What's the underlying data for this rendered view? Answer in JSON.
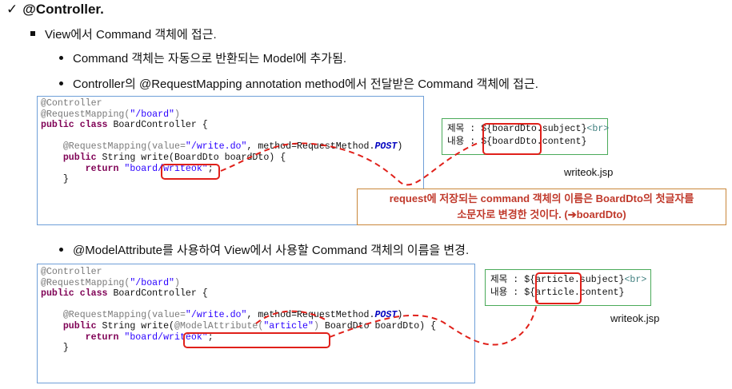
{
  "heading": {
    "check": "✓",
    "title": "@Controller."
  },
  "bullets": {
    "level1": "View에서 Command 객체에 접근.",
    "level2_a": "Command 객체는 자동으로 반환되는 Model에 추가됨.",
    "level2_b": "Controller의 @RequestMapping annotation method에서 전달받은 Command 객체에 접근.",
    "level2_c": "@ModelAttribute를 사용하여 View에서 사용할 Command 객체의 이름을 변경."
  },
  "example1": {
    "code": {
      "line1": "@Controller",
      "line2_ann": "@RequestMapping(",
      "line2_str": "\"/board\"",
      "line2_end": ")",
      "line3_kw1": "public",
      "line3_kw2": "class",
      "line3_rest": " BoardController {",
      "line5_ann": "@RequestMapping(value=",
      "line5_str": "\"/write.do\"",
      "line5_mid": ", method=RequestMethod.",
      "line5_const": "POST",
      "line5_end": ")",
      "line6_kw": "public",
      "line6_pre": " String write(",
      "line6_type": "BoardDto",
      "line6_rest": " boardDto) {",
      "line7_kw": "return",
      "line7_str": "\"board/writeok\"",
      "line7_end": ";",
      "line8": "}"
    },
    "jsp": {
      "label1": "제목 : $",
      "name1": "{boardDto.",
      "rest1": "subject}",
      "br": "<br>",
      "label2": "내용 : $",
      "name2": "{boardDto.",
      "rest2": "content}"
    },
    "jsp_caption": "writeok.jsp",
    "callout_line1": "request에 저장되는 command 객체의 이름은 BoardDto의 첫글자를",
    "callout_line2": "소문자로 변경한 것이다. (➔boardDto)"
  },
  "example2": {
    "code": {
      "line1": "@Controller",
      "line2_ann": "@RequestMapping(",
      "line2_str": "\"/board\"",
      "line2_end": ")",
      "line3_kw1": "public",
      "line3_kw2": "class",
      "line3_rest": " BoardController {",
      "line5_ann": "@RequestMapping(value=",
      "line5_str": "\"/write.do\"",
      "line5_mid": ", method=RequestMethod.",
      "line5_const": "POST",
      "line5_end": ")",
      "line6_kw": "public",
      "line6_pre": " String write(",
      "line6_ma": "@ModelAttribute(",
      "line6_ma_str": "\"article\"",
      "line6_ma_end": ")",
      "line6_rest": " BoardDto boardDto) {",
      "line7_kw": "return",
      "line7_str": "\"board/writeok\"",
      "line7_end": ";",
      "line8": "}"
    },
    "jsp": {
      "label1": "제목 : $",
      "name1": "{article.",
      "rest1": "subject}",
      "br": "<br>",
      "label2": "내용 : $",
      "name2": "{article.",
      "rest2": "content}"
    },
    "jsp_caption": "writeok.jsp"
  },
  "colors": {
    "highlight": "#e0201a",
    "code_border": "#6f9fd8",
    "jsp_border": "#4aaa5a",
    "callout_text": "#c0392b",
    "callout_border": "#c9873a"
  }
}
